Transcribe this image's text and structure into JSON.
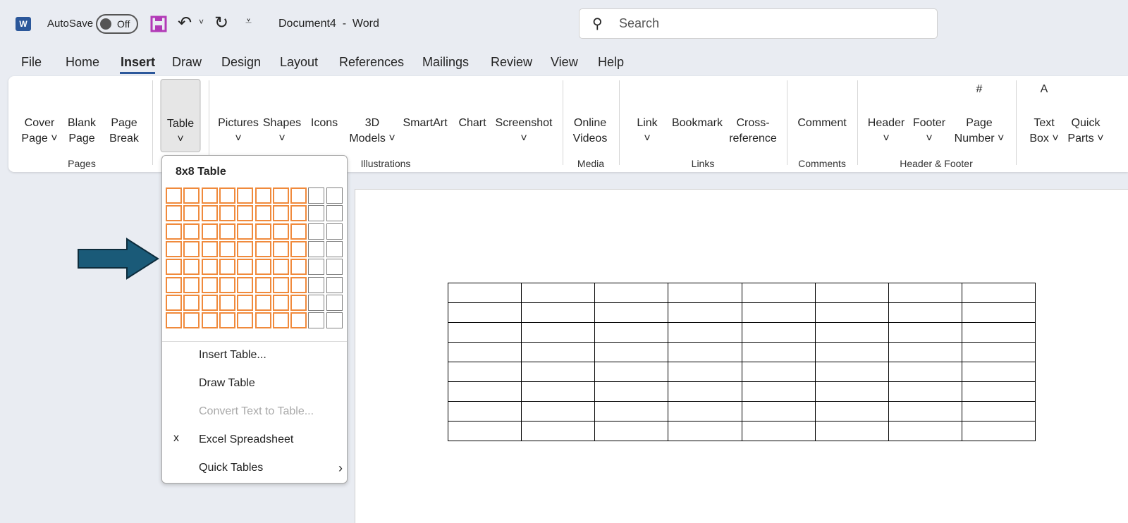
{
  "titlebar": {
    "app_icon": "word-icon",
    "autosave_label": "AutoSave",
    "autosave_state": "Off",
    "title": "Document4  -  Word",
    "search_placeholder": "Search"
  },
  "menu": {
    "tabs": [
      "File",
      "Home",
      "Insert",
      "Draw",
      "Design",
      "Layout",
      "References",
      "Mailings",
      "Review",
      "View",
      "Help"
    ],
    "active": "Insert"
  },
  "ribbon": {
    "buttons": [
      {
        "l1": "Cover",
        "l2": "Page ˅",
        "icon": "cover-page-icon"
      },
      {
        "l1": "Blank",
        "l2": "Page",
        "icon": "blank-page-icon"
      },
      {
        "l1": "Page",
        "l2": "Break",
        "icon": "page-break-icon"
      },
      {
        "l1": "Table",
        "l2": "˅",
        "icon": "table-icon"
      },
      {
        "l1": "Pictures",
        "l2": "˅",
        "icon": "pictures-icon"
      },
      {
        "l1": "Shapes",
        "l2": "˅",
        "icon": "shapes-icon"
      },
      {
        "l1": "Icons",
        "l2": "",
        "icon": "icons-icon"
      },
      {
        "l1": "3D",
        "l2": "Models ˅",
        "icon": "3d-models-icon"
      },
      {
        "l1": "SmartArt",
        "l2": "",
        "icon": "smartart-icon"
      },
      {
        "l1": "Chart",
        "l2": "",
        "icon": "chart-icon"
      },
      {
        "l1": "Screenshot",
        "l2": "˅",
        "icon": "screenshot-icon"
      },
      {
        "l1": "Online",
        "l2": "Videos",
        "icon": "online-videos-icon"
      },
      {
        "l1": "Link",
        "l2": "˅",
        "icon": "link-icon"
      },
      {
        "l1": "Bookmark",
        "l2": "",
        "icon": "bookmark-icon"
      },
      {
        "l1": "Cross-",
        "l2": "reference",
        "icon": "cross-reference-icon"
      },
      {
        "l1": "Comment",
        "l2": "",
        "icon": "comment-icon"
      },
      {
        "l1": "Header",
        "l2": "˅",
        "icon": "header-icon"
      },
      {
        "l1": "Footer",
        "l2": "˅",
        "icon": "footer-icon"
      },
      {
        "l1": "Page",
        "l2": "Number ˅",
        "icon": "page-number-icon"
      },
      {
        "l1": "Text",
        "l2": "Box ˅",
        "icon": "text-box-icon"
      },
      {
        "l1": "Quick",
        "l2": "Parts ˅",
        "icon": "quick-parts-icon"
      }
    ],
    "groups": [
      "Pages",
      "Illustrations",
      "Media",
      "Links",
      "Comments",
      "Header & Footer"
    ]
  },
  "table_dropdown": {
    "title": "8x8 Table",
    "grid_cols": 10,
    "grid_rows": 8,
    "selected_cols": 8,
    "selected_rows": 8,
    "items": [
      {
        "label": "Insert Table...",
        "icon": "insert-table-icon",
        "enabled": true
      },
      {
        "label": "Draw Table",
        "icon": "draw-table-icon",
        "enabled": true
      },
      {
        "label": "Convert Text to Table...",
        "icon": "convert-text-icon",
        "enabled": false
      },
      {
        "label": "Excel Spreadsheet",
        "icon": "excel-icon",
        "enabled": true
      },
      {
        "label": "Quick Tables",
        "icon": "quick-tables-icon",
        "enabled": true,
        "submenu": true
      }
    ]
  },
  "document": {
    "table_rows": 8,
    "table_cols": 8
  },
  "colors": {
    "accent": "#2b579a",
    "selection": "#f08a3c",
    "arrow": "#1a5a78"
  }
}
